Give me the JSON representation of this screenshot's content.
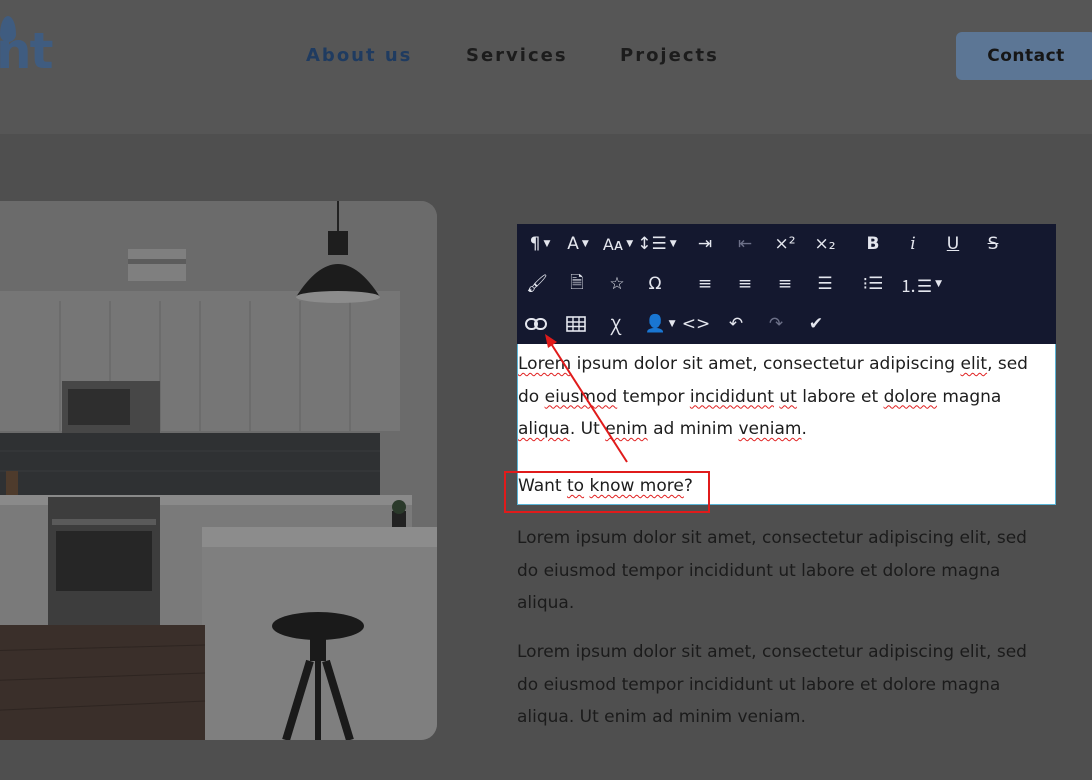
{
  "header": {
    "logo_text": "nt",
    "nav": [
      {
        "label": "About us",
        "active": true
      },
      {
        "label": "Services",
        "active": false
      },
      {
        "label": "Projects",
        "active": false
      }
    ],
    "contact_label": "Contact"
  },
  "toolbar": {
    "row1": [
      "paragraph-format",
      "font-family",
      "font-size",
      "line-height",
      "indent",
      "outdent",
      "superscript",
      "subscript",
      "bold",
      "italic",
      "underline",
      "strikethrough"
    ],
    "row2": [
      "paint-brush",
      "insert-file",
      "emoticons",
      "special-characters",
      "align-left",
      "align-center",
      "align-right",
      "align-justify",
      "bulleted-list",
      "numbered-list"
    ],
    "row3": [
      "insert-link",
      "insert-table",
      "clear-formatting",
      "user-placeholder",
      "code-view",
      "undo",
      "redo",
      "save-check"
    ]
  },
  "editor": {
    "line1_a": "Lorem",
    "line1_b": " ipsum dolor sit amet, consectetur adipiscing ",
    "line1_c": "elit",
    "line1_d": ", sed",
    "line2_a": "do ",
    "line2_b": "eiusmod",
    "line2_c": " tempor ",
    "line2_d": "incididunt",
    "line2_e": " ",
    "line2_f": "ut",
    "line2_g": " labore et ",
    "line2_h": "dolore",
    "line2_i": " magna",
    "line3_a": "aliqua",
    "line3_b": ". Ut ",
    "line3_c": "enim",
    "line3_d": " ad minim ",
    "line3_e": "veniam",
    "line3_f": ".",
    "cta_a": "Want ",
    "cta_b": "to",
    "cta_c": " ",
    "cta_d": "know more",
    "cta_e": "?"
  },
  "paragraphs": {
    "p1_line1": "Lorem ipsum dolor sit amet, consectetur adipiscing elit, sed",
    "p1_line2": "do eiusmod tempor incididunt ut labore et dolore magna",
    "p1_line3": "aliqua.",
    "p2_line1": "Lorem ipsum dolor sit amet, consectetur adipiscing elit, sed",
    "p2_line2": "do eiusmod tempor incididunt ut labore et dolore magna",
    "p2_line3": "aliqua. Ut enim ad minim veniam."
  },
  "colors": {
    "toolbar_bg": "#14182f",
    "accent": "#1f3b60",
    "highlight": "#e01b1b"
  }
}
